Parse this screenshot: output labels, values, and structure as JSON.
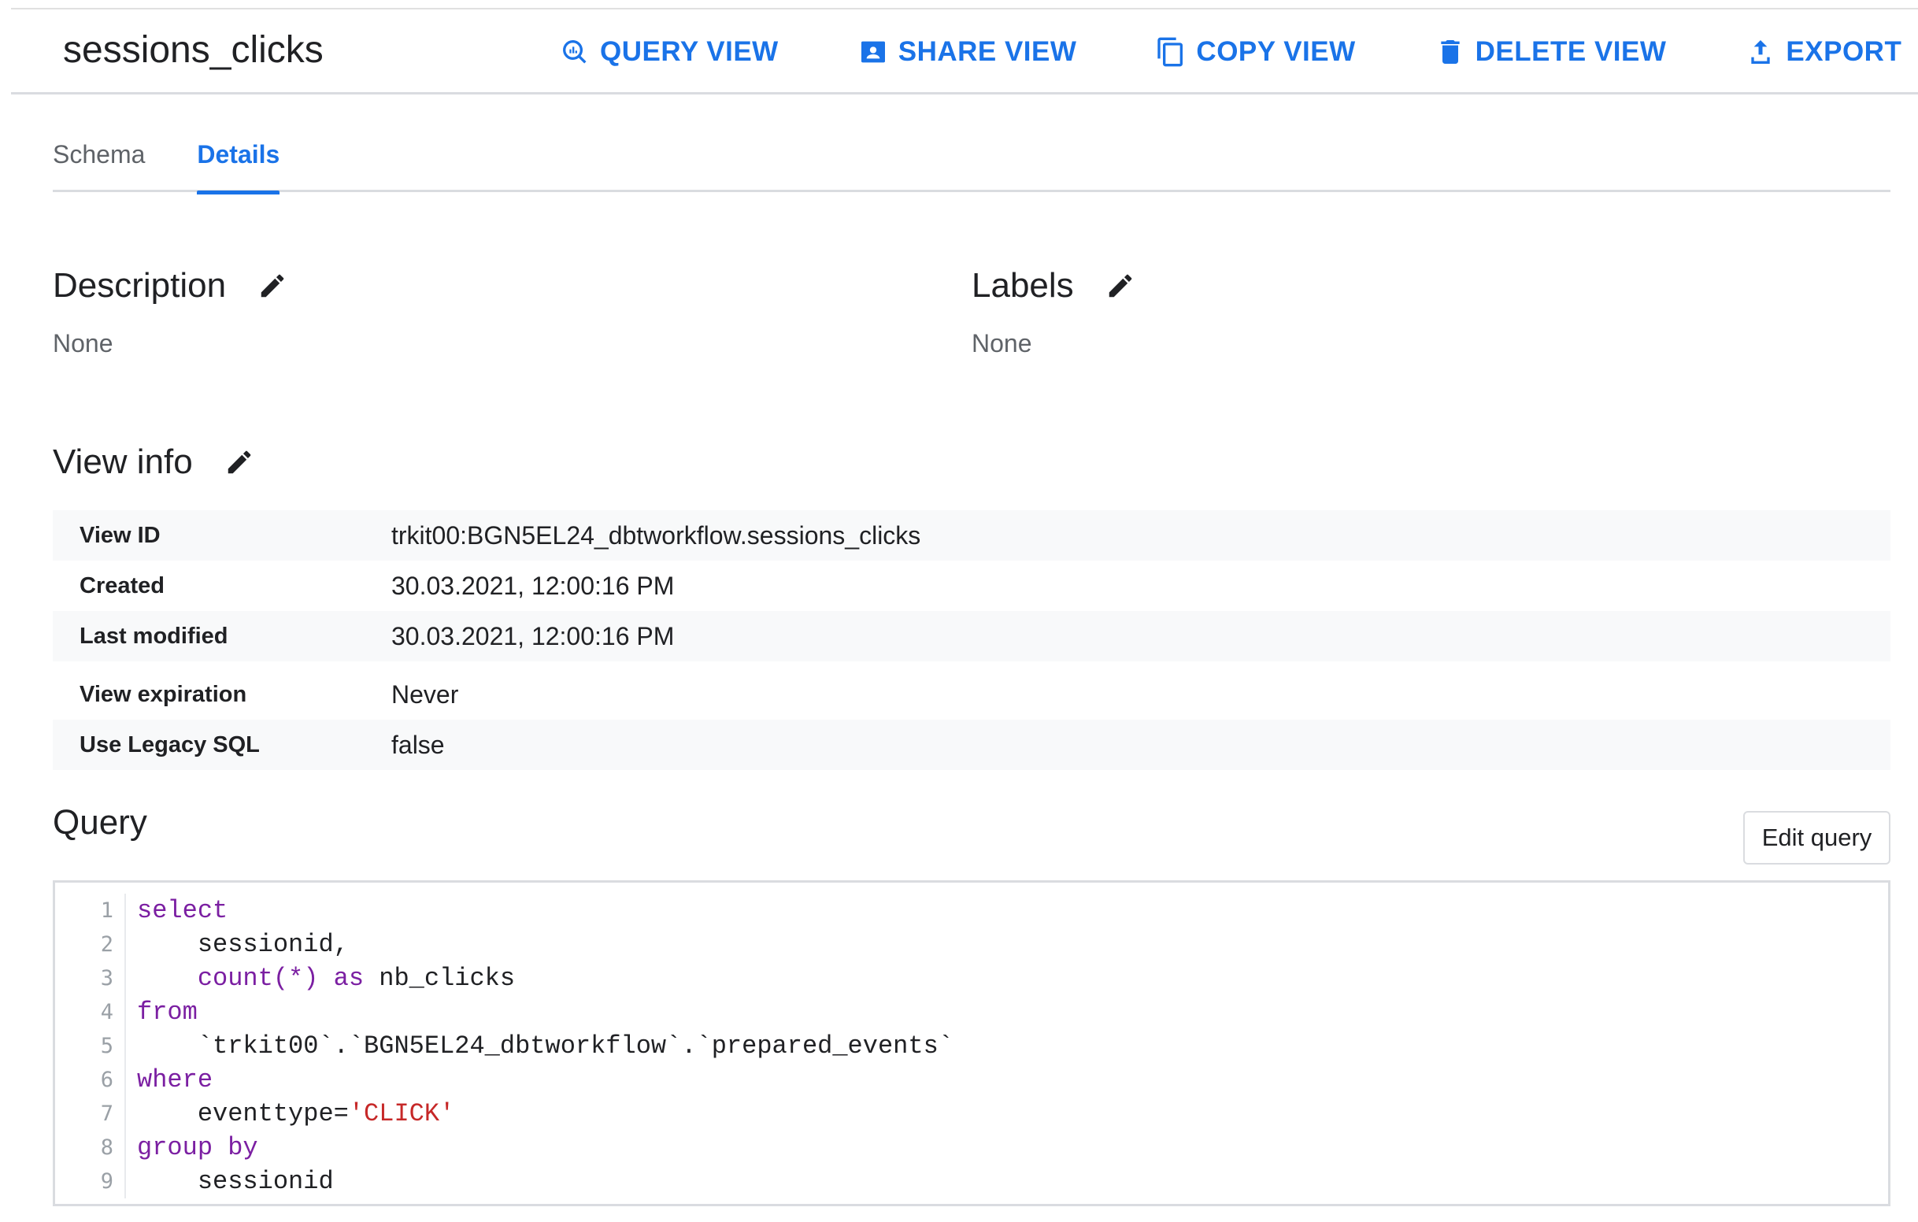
{
  "header": {
    "title": "sessions_clicks",
    "actions": [
      {
        "label": "QUERY VIEW",
        "icon": "query-icon"
      },
      {
        "label": "SHARE VIEW",
        "icon": "share-icon"
      },
      {
        "label": "COPY VIEW",
        "icon": "copy-icon"
      },
      {
        "label": "DELETE VIEW",
        "icon": "delete-icon"
      },
      {
        "label": "EXPORT",
        "icon": "export-icon"
      }
    ]
  },
  "tabs": [
    {
      "label": "Schema",
      "active": false
    },
    {
      "label": "Details",
      "active": true
    }
  ],
  "description": {
    "heading": "Description",
    "value": "None"
  },
  "labels": {
    "heading": "Labels",
    "value": "None"
  },
  "view_info": {
    "heading": "View info",
    "rows": [
      {
        "key": "View ID",
        "value": "trkit00:BGN5EL24_dbtworkflow.sessions_clicks"
      },
      {
        "key": "Created",
        "value": "30.03.2021, 12:00:16 PM"
      },
      {
        "key": "Last modified",
        "value": "30.03.2021, 12:00:16 PM"
      },
      {
        "key": "View expiration",
        "value": "Never"
      },
      {
        "key": "Use Legacy SQL",
        "value": "false"
      }
    ]
  },
  "query": {
    "heading": "Query",
    "edit_label": "Edit query",
    "line_numbers": [
      "1",
      "2",
      "3",
      "4",
      "5",
      "6",
      "7",
      "8",
      "9"
    ],
    "lines": {
      "l1": "select",
      "l2": "    sessionid,",
      "l3a": "    count(*) ",
      "l3b": "as",
      "l3c": " nb_clicks",
      "l4": "from",
      "l5": "    `trkit00`.`BGN5EL24_dbtworkflow`.`prepared_events`",
      "l6": "where",
      "l7a": "    eventtype=",
      "l7b": "'CLICK'",
      "l8": "group by",
      "l9": "    sessionid"
    }
  },
  "colors": {
    "accent": "#1a73e8",
    "keyword": "#7b1fa2",
    "string": "#c62828"
  }
}
